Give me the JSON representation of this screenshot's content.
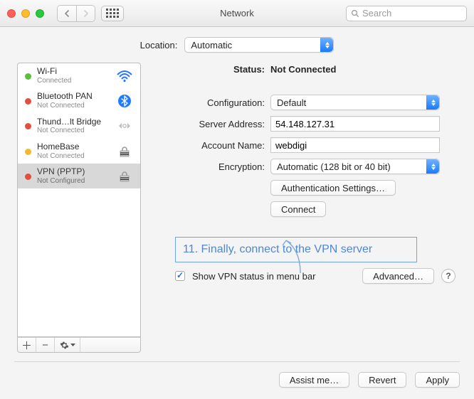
{
  "window": {
    "title": "Network",
    "search_placeholder": "Search"
  },
  "location": {
    "label": "Location:",
    "value": "Automatic"
  },
  "sidebar": {
    "items": [
      {
        "name": "Wi-Fi",
        "status": "Connected",
        "dot": "green",
        "icon": "wifi"
      },
      {
        "name": "Bluetooth PAN",
        "status": "Not Connected",
        "dot": "red",
        "icon": "bluetooth"
      },
      {
        "name": "Thund…lt Bridge",
        "status": "Not Connected",
        "dot": "red",
        "icon": "thunderbolt"
      },
      {
        "name": "HomeBase",
        "status": "Not Connected",
        "dot": "yellow",
        "icon": "lock"
      },
      {
        "name": "VPN (PPTP)",
        "status": "Not Configured",
        "dot": "red",
        "icon": "lock",
        "selected": true
      }
    ],
    "footer": {
      "plus": "＋",
      "minus": "−"
    }
  },
  "detail": {
    "status_label": "Status:",
    "status_value": "Not Connected",
    "config_label": "Configuration:",
    "config_value": "Default",
    "server_label": "Server Address:",
    "server_value": "54.148.127.31",
    "account_label": "Account Name:",
    "account_value": "webdigi",
    "enc_label": "Encryption:",
    "enc_value": "Automatic (128 bit or 40 bit)",
    "auth_btn": "Authentication Settings…",
    "connect_btn": "Connect",
    "annot_text": "11. Finally, connect to the VPN server",
    "show_status_label": "Show VPN status in menu bar",
    "advanced_btn": "Advanced…",
    "help": "?"
  },
  "footer": {
    "assist": "Assist me…",
    "revert": "Revert",
    "apply": "Apply"
  }
}
